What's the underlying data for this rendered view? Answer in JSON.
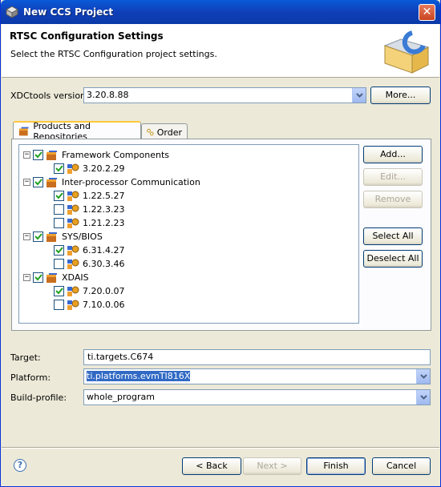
{
  "window": {
    "title": "New CCS Project",
    "close_glyph": "✕"
  },
  "header": {
    "title": "RTSC Configuration Settings",
    "description": "Select the RTSC Configuration project settings."
  },
  "xdctools": {
    "label": "XDCtools version:",
    "value": "3.20.8.88",
    "more_label": "More..."
  },
  "tabs": [
    {
      "label": "Products and Repositories",
      "active": true
    },
    {
      "label": "Order",
      "active": false
    }
  ],
  "tree": {
    "groups": [
      {
        "label": "Framework Components",
        "checked": true,
        "versions": [
          {
            "label": "3.20.2.29",
            "checked": true
          }
        ]
      },
      {
        "label": "Inter-processor Communication",
        "checked": true,
        "versions": [
          {
            "label": "1.22.5.27",
            "checked": true
          },
          {
            "label": "1.22.3.23",
            "checked": false
          },
          {
            "label": "1.21.2.23",
            "checked": false
          }
        ]
      },
      {
        "label": "SYS/BIOS",
        "checked": true,
        "versions": [
          {
            "label": "6.31.4.27",
            "checked": true
          },
          {
            "label": "6.30.3.46",
            "checked": false
          }
        ]
      },
      {
        "label": "XDAIS",
        "checked": true,
        "versions": [
          {
            "label": "7.20.0.07",
            "checked": true
          },
          {
            "label": "7.10.0.06",
            "checked": false
          }
        ]
      }
    ],
    "expand_glyph": "−"
  },
  "side_buttons": {
    "add": "Add...",
    "edit": "Edit...",
    "remove": "Remove",
    "select_all": "Select All",
    "deselect_all": "Deselect All"
  },
  "settings": {
    "target_label": "Target:",
    "target_value": "ti.targets.C674",
    "platform_label": "Platform:",
    "platform_value": "ti.platforms.evmTI816X",
    "build_profile_label": "Build-profile:",
    "build_profile_value": "whole_program"
  },
  "footer": {
    "help_glyph": "?",
    "back": "< Back",
    "next": "Next >",
    "finish": "Finish",
    "cancel": "Cancel"
  },
  "colors": {
    "titlebar": "#0a5ad8",
    "selection": "#316ac5",
    "check": "#21a121"
  },
  "icons": [
    "app-icon",
    "close-icon",
    "folder-c-icon",
    "combo-arrow-icon",
    "package-icon",
    "version-icon",
    "order-icon",
    "help-icon"
  ]
}
